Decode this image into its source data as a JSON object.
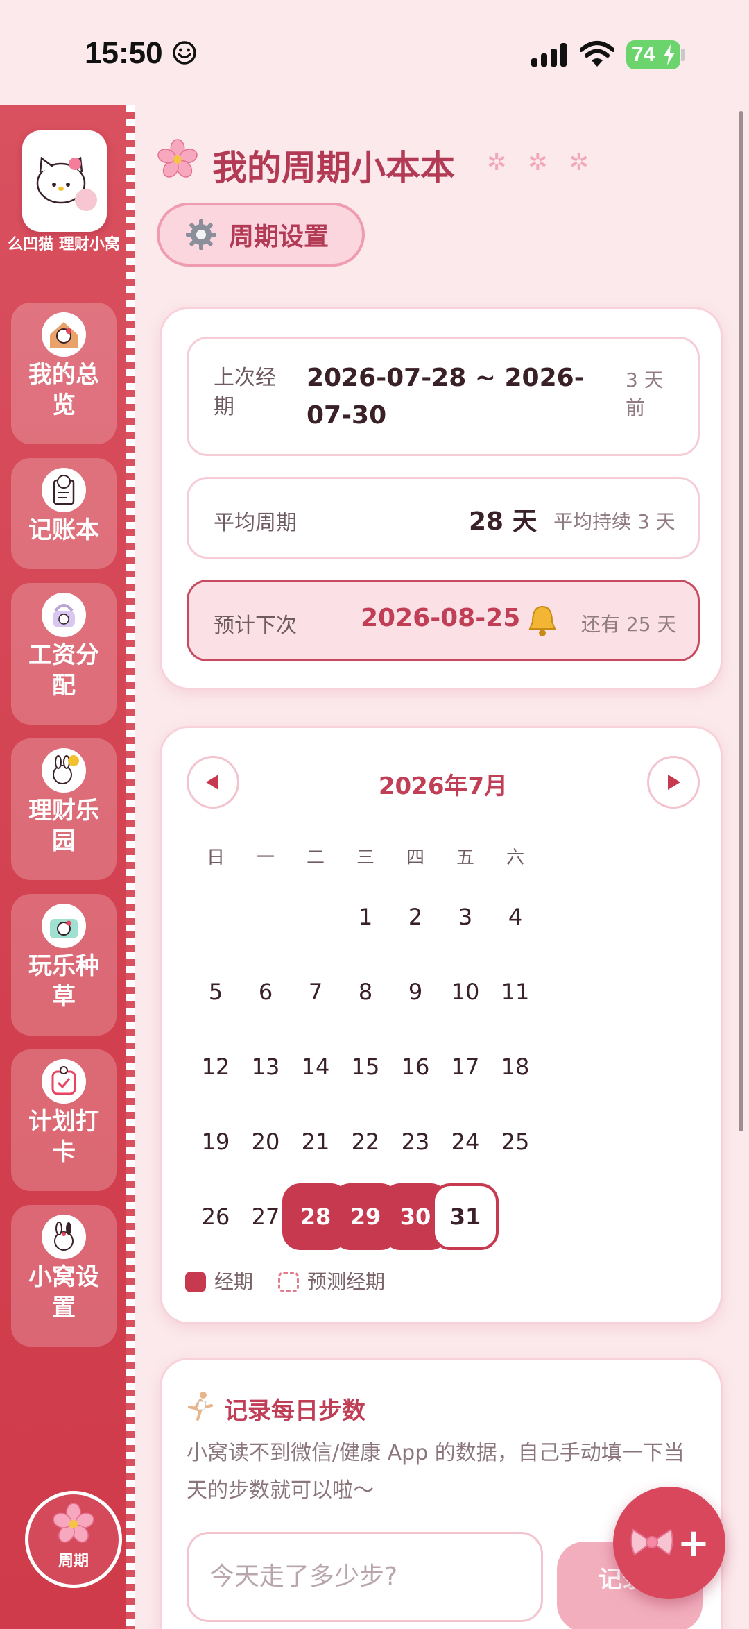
{
  "status_bar": {
    "time": "15:50",
    "battery": "74"
  },
  "sidebar": {
    "app_name": "么凹猫 理财小窝",
    "items": [
      {
        "label": "我的总览",
        "icon": "hello-kitty-house-icon"
      },
      {
        "label": "记账本",
        "icon": "kitty-note-icon"
      },
      {
        "label": "工资分配",
        "icon": "kitty-bag-icon"
      },
      {
        "label": "理财乐园",
        "icon": "bunny-coin-icon"
      },
      {
        "label": "玩乐种草",
        "icon": "kitty-camera-icon"
      },
      {
        "label": "计划打卡",
        "icon": "checkin-calendar-icon"
      },
      {
        "label": "小窝设置",
        "icon": "bunny-settings-icon"
      }
    ],
    "bottom_label": "周期"
  },
  "header": {
    "title": "我的周期小本本",
    "sparkles": "✲ ✲ ✲",
    "settings_label": "周期设置"
  },
  "summary": {
    "last_label": "上次经期",
    "last_value": "2026-07-28 ~ 2026-07-30",
    "last_ago": "3 天前",
    "avg_label": "平均周期",
    "avg_value": "28 天",
    "avg_duration": "平均持续 3 天",
    "next_label": "预计下次",
    "next_value": "2026-08-25",
    "next_remaining": "还有 25 天"
  },
  "calendar": {
    "month_title": "2026年7月",
    "weekdays": [
      "日",
      "一",
      "二",
      "三",
      "四",
      "五",
      "六"
    ],
    "first_weekday": 3,
    "days_in_month": 31,
    "period_days": [
      28,
      29,
      30
    ],
    "today": 31,
    "legend_period": "经期",
    "legend_predicted": "预测经期"
  },
  "steps": {
    "title": "记录每日步数",
    "description": "小窝读不到微信/健康 App 的数据，自己手动填一下当天的步数就可以啦～",
    "placeholder": "今天走了多少步?",
    "button_label": "记录"
  },
  "colors": {
    "accent": "#c7394e",
    "sidebar": "#d2404f",
    "background": "#fbe9ec"
  }
}
